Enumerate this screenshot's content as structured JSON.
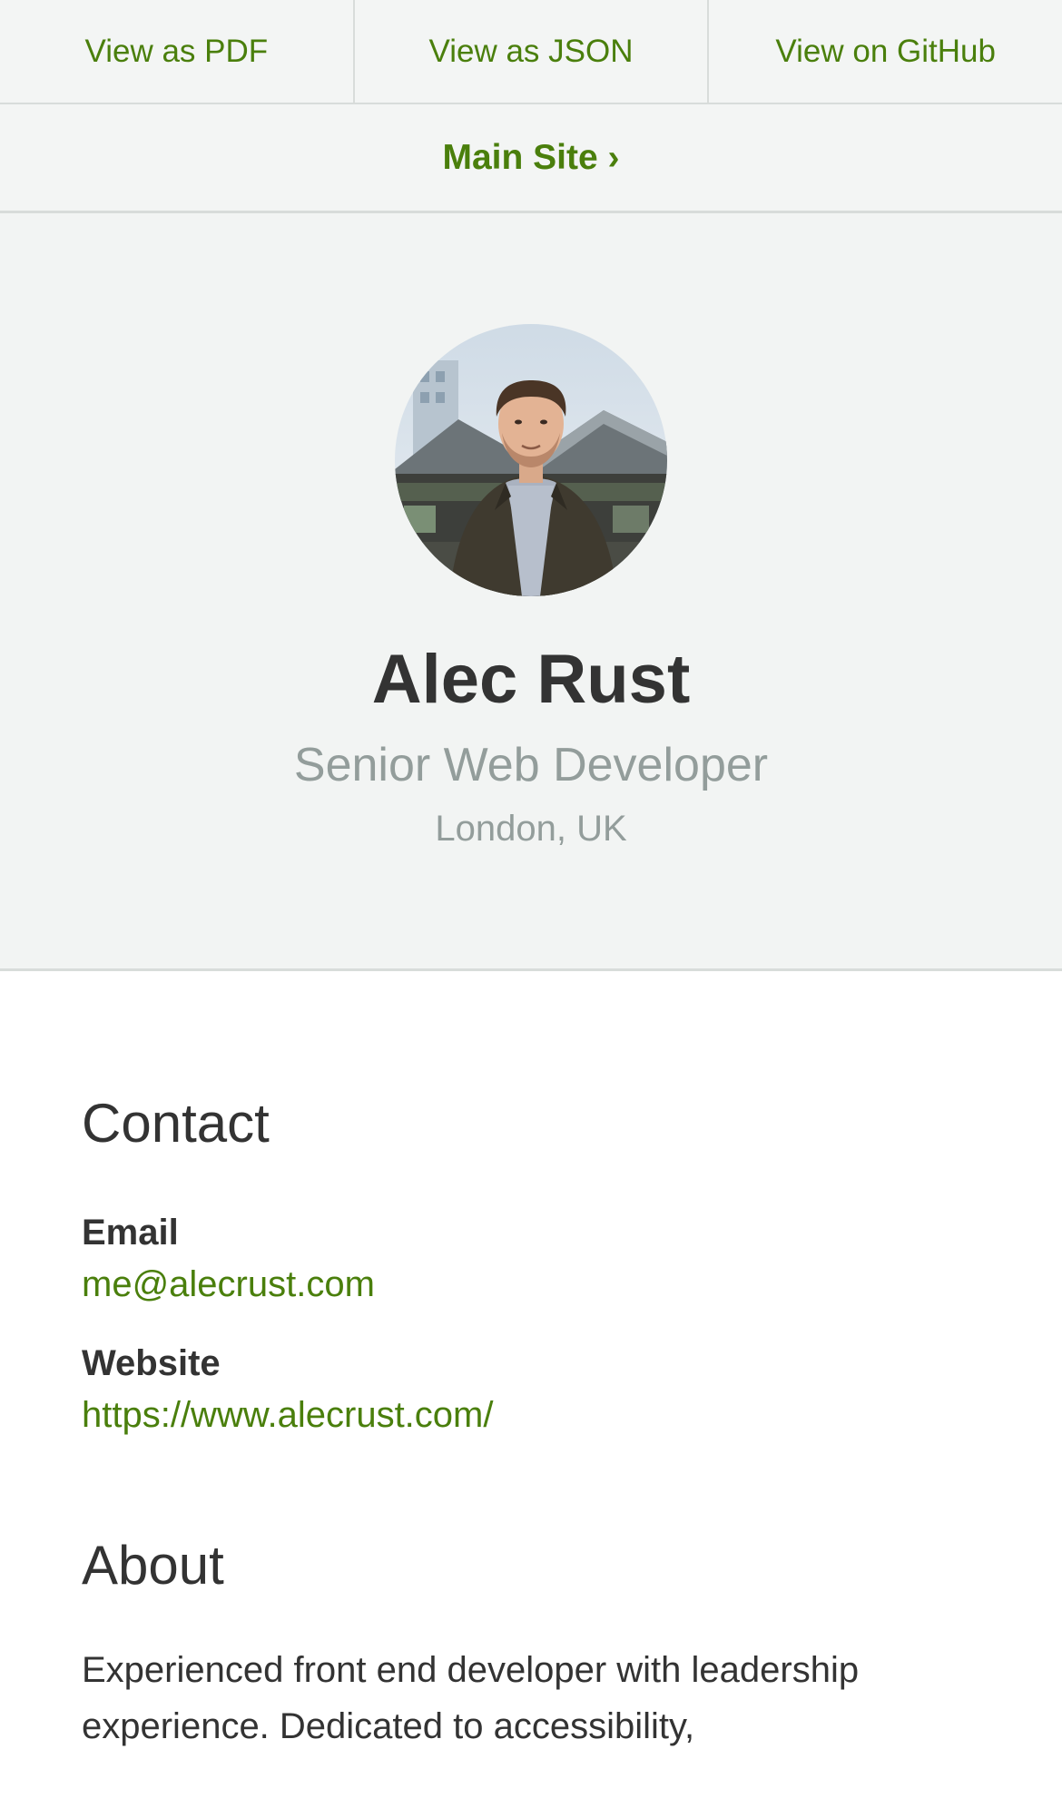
{
  "nav": {
    "pdf_label": "View as PDF",
    "json_label": "View as JSON",
    "github_label": "View on GitHub",
    "main_site_label": "Main Site ›"
  },
  "profile": {
    "name": "Alec Rust",
    "role": "Senior Web Developer",
    "location": "London, UK",
    "avatar_alt": "Alec Rust"
  },
  "contact": {
    "heading": "Contact",
    "email_label": "Email",
    "email_value": "me@alecrust.com",
    "website_label": "Website",
    "website_value": "https://www.alecrust.com/"
  },
  "about": {
    "heading": "About",
    "text": "Experienced front end developer with leadership experience. Dedicated to accessibility,"
  },
  "colors": {
    "accent": "#4a7f0c",
    "muted": "#939d9b",
    "header_bg": "#f2f4f3",
    "text": "#333333"
  }
}
